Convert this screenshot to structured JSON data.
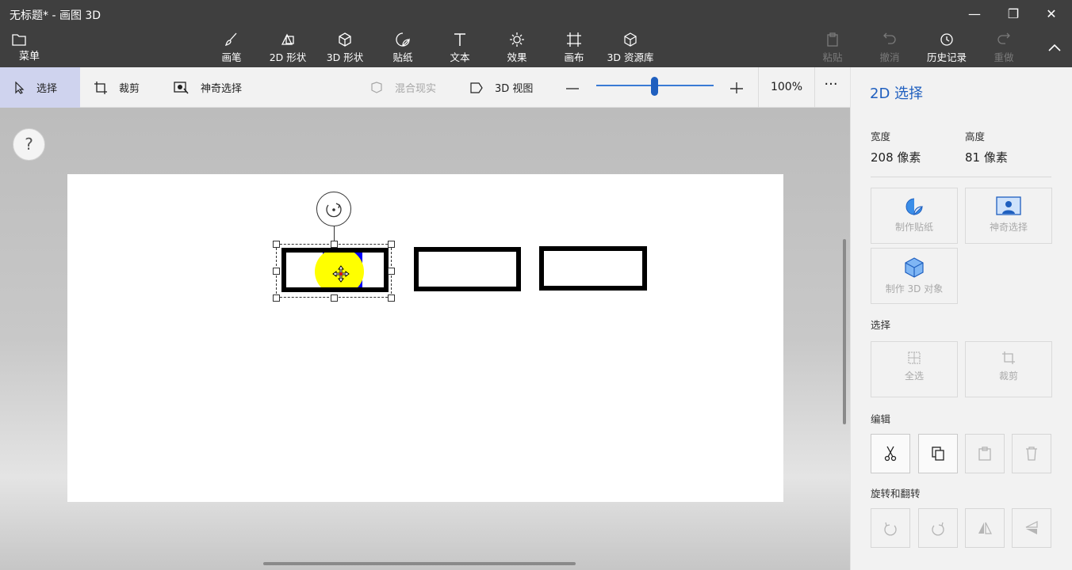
{
  "window": {
    "title": "无标题* - 画图 3D",
    "minimize": "—",
    "restore": "❐",
    "close": "✕"
  },
  "ribbon": {
    "menu_label": "菜单",
    "tools": [
      {
        "label": "画笔",
        "icon": "brush-icon"
      },
      {
        "label": "2D 形状",
        "icon": "2d-shapes-icon"
      },
      {
        "label": "3D 形状",
        "icon": "3d-shapes-icon"
      },
      {
        "label": "贴纸",
        "icon": "stickers-icon"
      },
      {
        "label": "文本",
        "icon": "text-icon"
      },
      {
        "label": "效果",
        "icon": "effects-icon"
      },
      {
        "label": "画布",
        "icon": "canvas-icon"
      },
      {
        "label": "3D 资源库",
        "icon": "3d-library-icon"
      }
    ],
    "actions": [
      {
        "label": "粘贴",
        "enabled": false
      },
      {
        "label": "撤消",
        "enabled": false
      },
      {
        "label": "历史记录",
        "enabled": true
      },
      {
        "label": "重做",
        "enabled": false
      }
    ]
  },
  "subtoolbar": {
    "select": "选择",
    "crop": "裁剪",
    "magic_select": "神奇选择",
    "mixed_reality": "混合现实",
    "view_3d": "3D 视图",
    "zoom_value": "100%",
    "zoom_level": 0.5,
    "more": "···"
  },
  "help": "?",
  "panel": {
    "title": "2D 选择",
    "width_label": "宽度",
    "width_value": "208 像素",
    "height_label": "高度",
    "height_value": "81 像素",
    "make_sticker": "制作贴纸",
    "magic_select": "神奇选择",
    "make_3d": "制作 3D 对象",
    "select_section": "选择",
    "select_all": "全选",
    "crop": "裁剪",
    "edit_section": "编辑",
    "rotate_section": "旋转和翻转"
  },
  "colors": {
    "accent": "#1f5fbf",
    "highlight": "#ffff00",
    "selection_fill": "#0000ff"
  }
}
